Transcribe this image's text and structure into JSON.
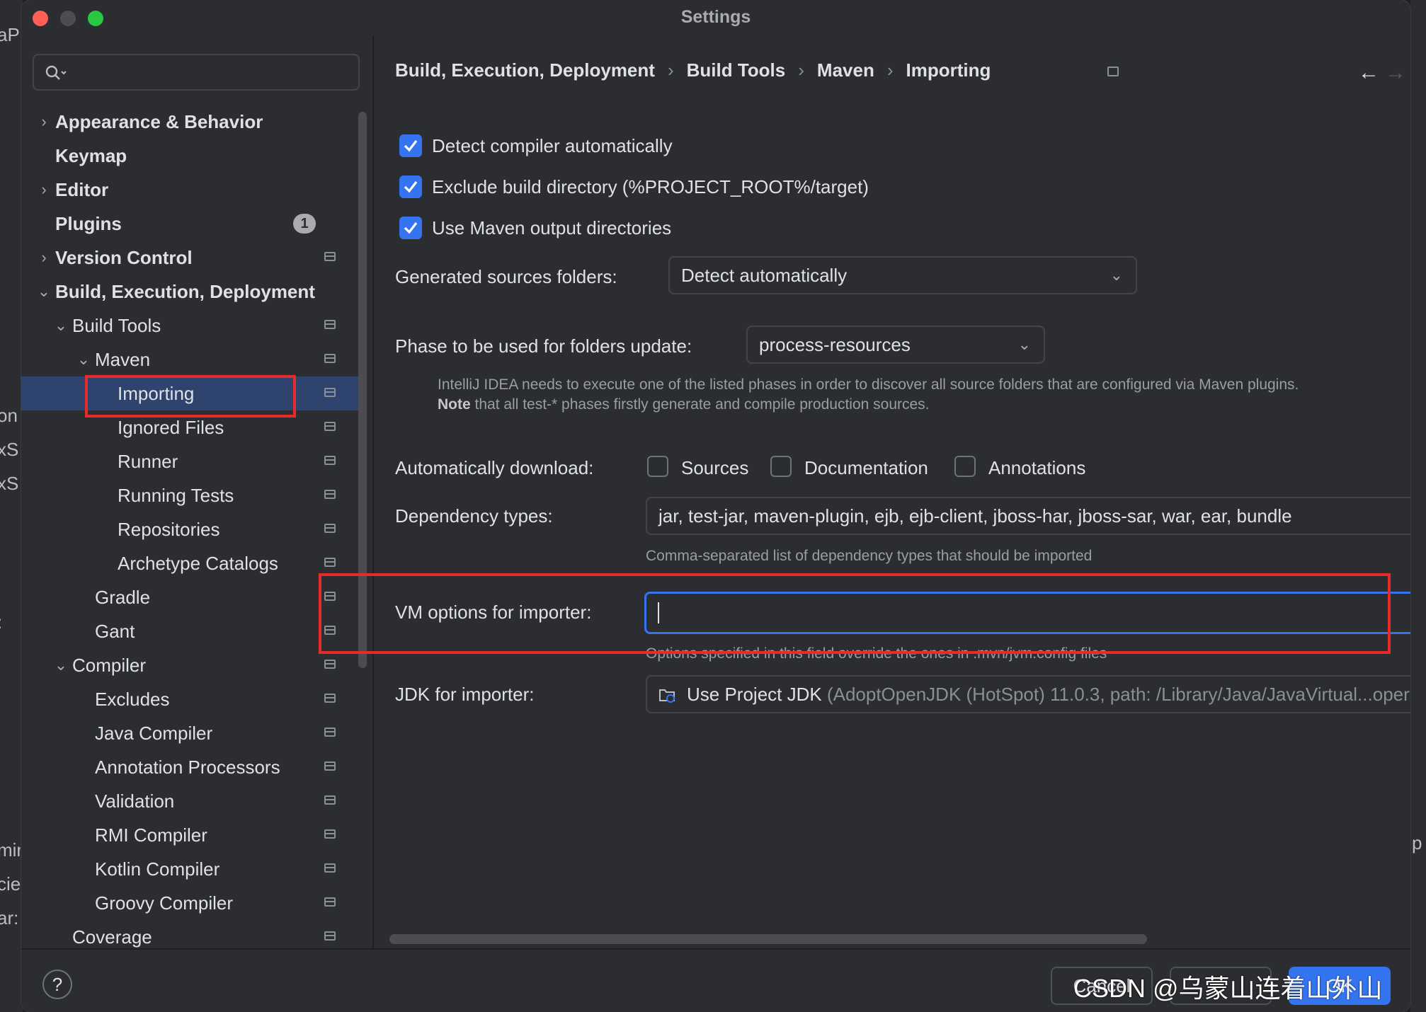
{
  "window": {
    "title": "Settings"
  },
  "background": {
    "left_fragments": [
      "aPr",
      "on",
      "xS",
      "xS",
      ":",
      "min",
      "cie",
      "ar:"
    ],
    "right_fragments": [
      "p"
    ]
  },
  "sidebar": {
    "search": {
      "value": "",
      "placeholder": ""
    },
    "items": [
      {
        "label": "Appearance & Behavior",
        "expanded": false,
        "bold": true
      },
      {
        "label": "Keymap",
        "bold": true
      },
      {
        "label": "Editor",
        "expanded": false,
        "bold": true
      },
      {
        "label": "Plugins",
        "bold": true,
        "badge": "1"
      },
      {
        "label": "Version Control",
        "expanded": false,
        "bold": true
      },
      {
        "label": "Build, Execution, Deployment",
        "expanded": true,
        "bold": true
      },
      {
        "label": "Build Tools",
        "expanded": true
      },
      {
        "label": "Maven",
        "expanded": true
      },
      {
        "label": "Importing",
        "selected": true
      },
      {
        "label": "Ignored Files"
      },
      {
        "label": "Runner"
      },
      {
        "label": "Running Tests"
      },
      {
        "label": "Repositories"
      },
      {
        "label": "Archetype Catalogs"
      },
      {
        "label": "Gradle"
      },
      {
        "label": "Gant"
      },
      {
        "label": "Compiler",
        "expanded": true
      },
      {
        "label": "Excludes"
      },
      {
        "label": "Java Compiler"
      },
      {
        "label": "Annotation Processors"
      },
      {
        "label": "Validation"
      },
      {
        "label": "RMI Compiler"
      },
      {
        "label": "Kotlin Compiler"
      },
      {
        "label": "Groovy Compiler"
      },
      {
        "label": "Coverage"
      }
    ]
  },
  "breadcrumb": [
    "Build, Execution, Deployment",
    "Build Tools",
    "Maven",
    "Importing"
  ],
  "settings": {
    "checkboxes": [
      {
        "label": "Detect compiler automatically",
        "checked": true
      },
      {
        "label": "Exclude build directory (%PROJECT_ROOT%/target)",
        "checked": true
      },
      {
        "label": "Use Maven output directories",
        "checked": true
      }
    ],
    "generated_sources": {
      "label": "Generated sources folders:",
      "value": "Detect automatically"
    },
    "phase": {
      "label": "Phase to be used for folders update:",
      "value": "process-resources"
    },
    "phase_hint_line1": "IntelliJ IDEA needs to execute one of the listed phases in order to discover all source folders that are configured via Maven plugins.",
    "phase_hint_note": "Note",
    "phase_hint_line2": " that all test-* phases firstly generate and compile production sources.",
    "auto_download": {
      "label": "Automatically download:",
      "options": [
        {
          "label": "Sources",
          "checked": false
        },
        {
          "label": "Documentation",
          "checked": false
        },
        {
          "label": "Annotations",
          "checked": false
        }
      ]
    },
    "dependency_types": {
      "label": "Dependency types:",
      "value": "jar, test-jar, maven-plugin, ejb, ejb-client, jboss-har, jboss-sar, war, ear, bundle",
      "hint": "Comma-separated list of dependency types that should be imported"
    },
    "vm_options": {
      "label": "VM options for importer:",
      "value": "",
      "hint": "Options specified in this field override the ones in .mvn/jvm.config files"
    },
    "jdk": {
      "label": "JDK for importer:",
      "value": "Use Project JDK",
      "detail": " (AdoptOpenJDK (HotSpot) 11.0.3, path: /Library/Java/JavaVirtual...oper"
    }
  },
  "footer": {
    "help": "?",
    "cancel": "Cancel",
    "apply": "",
    "ok": "OK",
    "watermark": "CSDN @乌蒙山连着山外山"
  },
  "colors": {
    "accent": "#3574f0",
    "selection": "#2e436e",
    "highlight_box": "#e82a2a",
    "window_bg": "#2b2d30"
  }
}
